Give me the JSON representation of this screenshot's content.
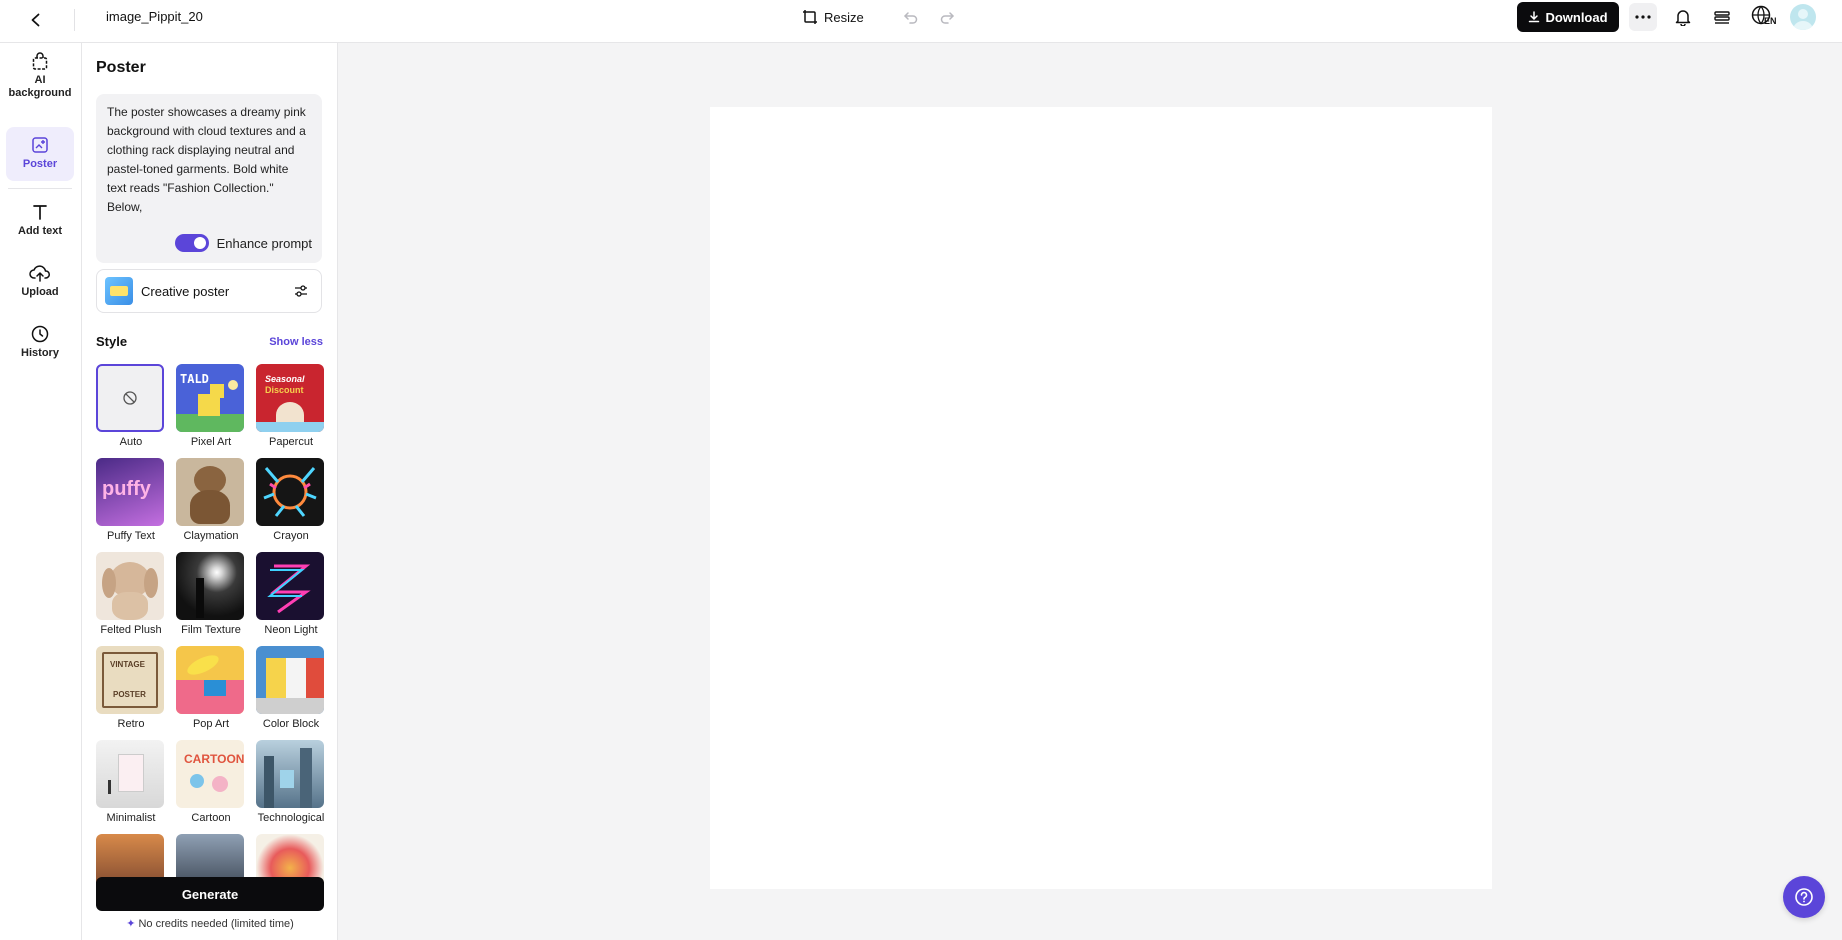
{
  "header": {
    "doc_title": "image_Pippit_20",
    "resize_label": "Resize",
    "download_label": "Download",
    "lang_code": "EN"
  },
  "rail": {
    "items": [
      {
        "label": "AI background",
        "icon": "bag-icon"
      },
      {
        "label": "Poster",
        "icon": "poster-icon"
      },
      {
        "label": "Add text",
        "icon": "text-icon"
      },
      {
        "label": "Upload",
        "icon": "cloud-upload-icon"
      },
      {
        "label": "History",
        "icon": "clock-icon"
      }
    ],
    "active": "Poster"
  },
  "panel": {
    "title": "Poster",
    "prompt": "The poster showcases a dreamy pink background with cloud textures and a clothing rack displaying neutral and pastel-toned garments. Bold white text reads \"Fashion Collection.\" Below,",
    "enhance_label": "Enhance prompt",
    "enhance_on": true,
    "template_label": "Creative poster",
    "style_heading": "Style",
    "show_less": "Show less",
    "styles": [
      "Auto",
      "Pixel Art",
      "Papercut",
      "Puffy Text",
      "Claymation",
      "Crayon",
      "Felted Plush",
      "Film Texture",
      "Neon Light",
      "Retro",
      "Pop Art",
      "Color Block",
      "Minimalist",
      "Cartoon",
      "Technological"
    ],
    "thumb_texts": {
      "pixel": "TALD",
      "papercut_top": "Seasonal",
      "papercut_bottom": "Discount",
      "puffy": "puffy",
      "retro_top": "VINTAGE",
      "retro_bottom": "POSTER",
      "cartoon": "CARTOON"
    },
    "selected_style": "Auto",
    "generate_label": "Generate",
    "credits_note": "No credits needed (limited time)"
  },
  "colors": {
    "accent": "#5b45d9",
    "canvas_bg": "#f4f4f5",
    "button_dark": "#0b0b0d"
  }
}
